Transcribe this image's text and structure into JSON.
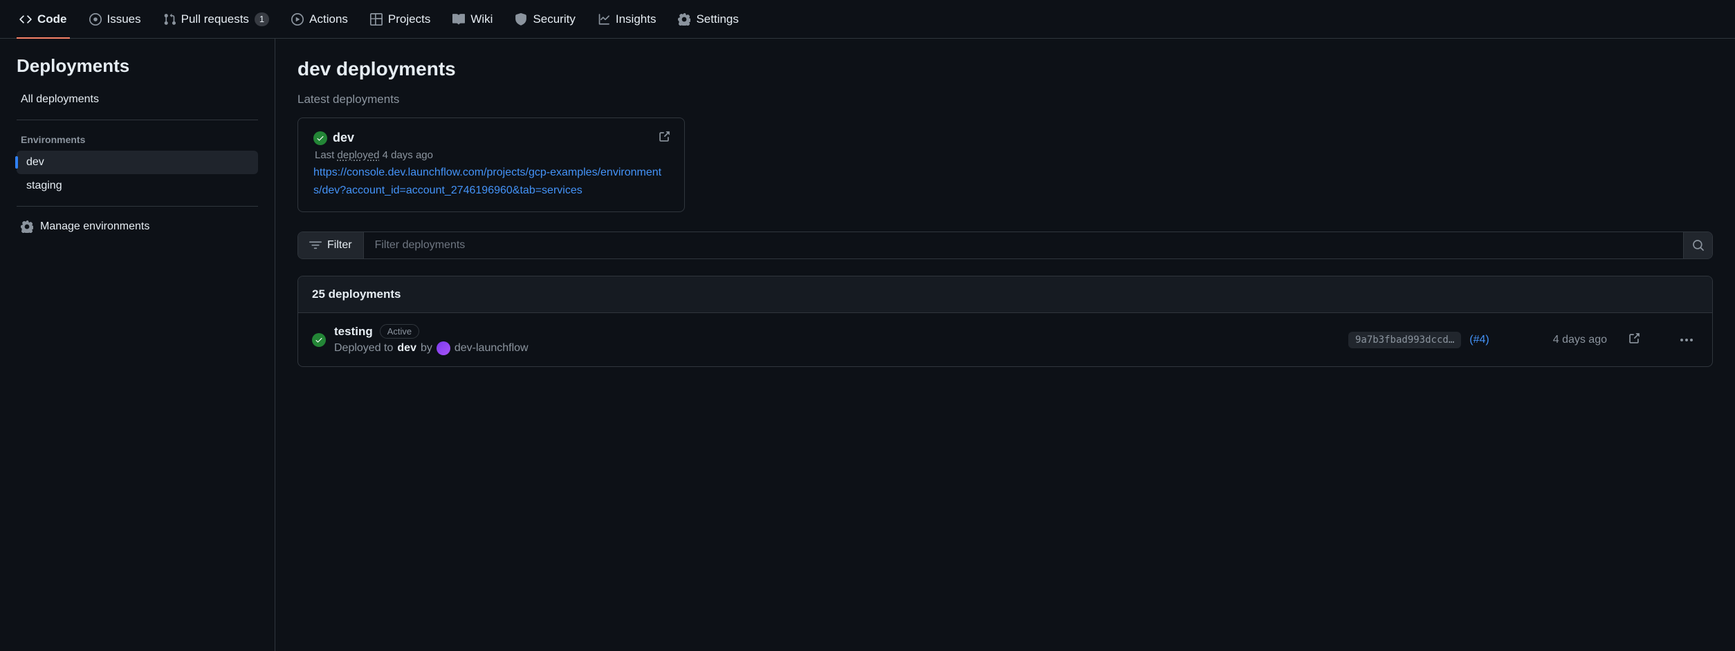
{
  "nav": {
    "code": "Code",
    "issues": "Issues",
    "pull_requests": "Pull requests",
    "pr_count": "1",
    "actions": "Actions",
    "projects": "Projects",
    "wiki": "Wiki",
    "security": "Security",
    "insights": "Insights",
    "settings": "Settings"
  },
  "sidebar": {
    "title": "Deployments",
    "all": "All deployments",
    "env_heading": "Environments",
    "envs": [
      "dev",
      "staging"
    ],
    "manage": "Manage environments"
  },
  "content": {
    "title": "dev deployments",
    "subhead": "Latest deployments",
    "latest": {
      "name": "dev",
      "last_prefix": "Last ",
      "last_link": "deployed",
      "last_time": " 4 days ago",
      "url": "https://console.dev.launchflow.com/projects/gcp-examples/environments/dev?account_id=account_2746196960&tab=services"
    },
    "filter": {
      "button": "Filter",
      "placeholder": "Filter deployments"
    },
    "list": {
      "count_label": "25 deployments",
      "rows": [
        {
          "name": "testing",
          "badge": "Active",
          "meta_prefix": "Deployed to ",
          "env": "dev",
          "by": " by ",
          "actor": "dev-launchflow",
          "sha": "9a7b3fbad993dccd…",
          "pr": "(#4)",
          "time": "4 days ago"
        }
      ]
    }
  }
}
